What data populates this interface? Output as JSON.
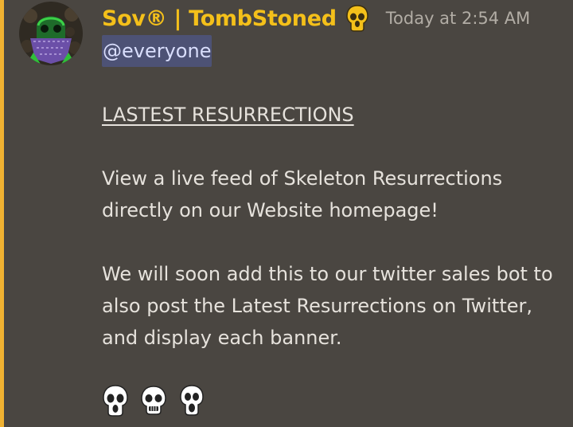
{
  "message": {
    "author": "Sov® | TombStoned",
    "timestamp": "Today at 2:54 AM",
    "mention": "@everyone",
    "heading": "LASTEST RESURRECTIONS",
    "paragraph1": [
      "View a live feed of Skeleton Resurrections",
      "directly on our Website homepage!"
    ],
    "paragraph2": [
      "We will soon add this to our twitter sales bot to",
      "also post the Latest Resurrections on Twitter,",
      "and display each banner."
    ],
    "emojis": [
      "skull-emoji",
      "skull-emoji",
      "skull-emoji"
    ]
  },
  "colors": {
    "background": "#4a4641",
    "mention_bar": "#f0b232",
    "username": "#f4c01a",
    "mention_bg": "#4d5275",
    "text": "#e6e2dc",
    "timestamp": "#b2ada5"
  },
  "icons": {
    "role_icon": "yellow-skull-icon",
    "avatar": "skeleton-bandana-avatar"
  }
}
